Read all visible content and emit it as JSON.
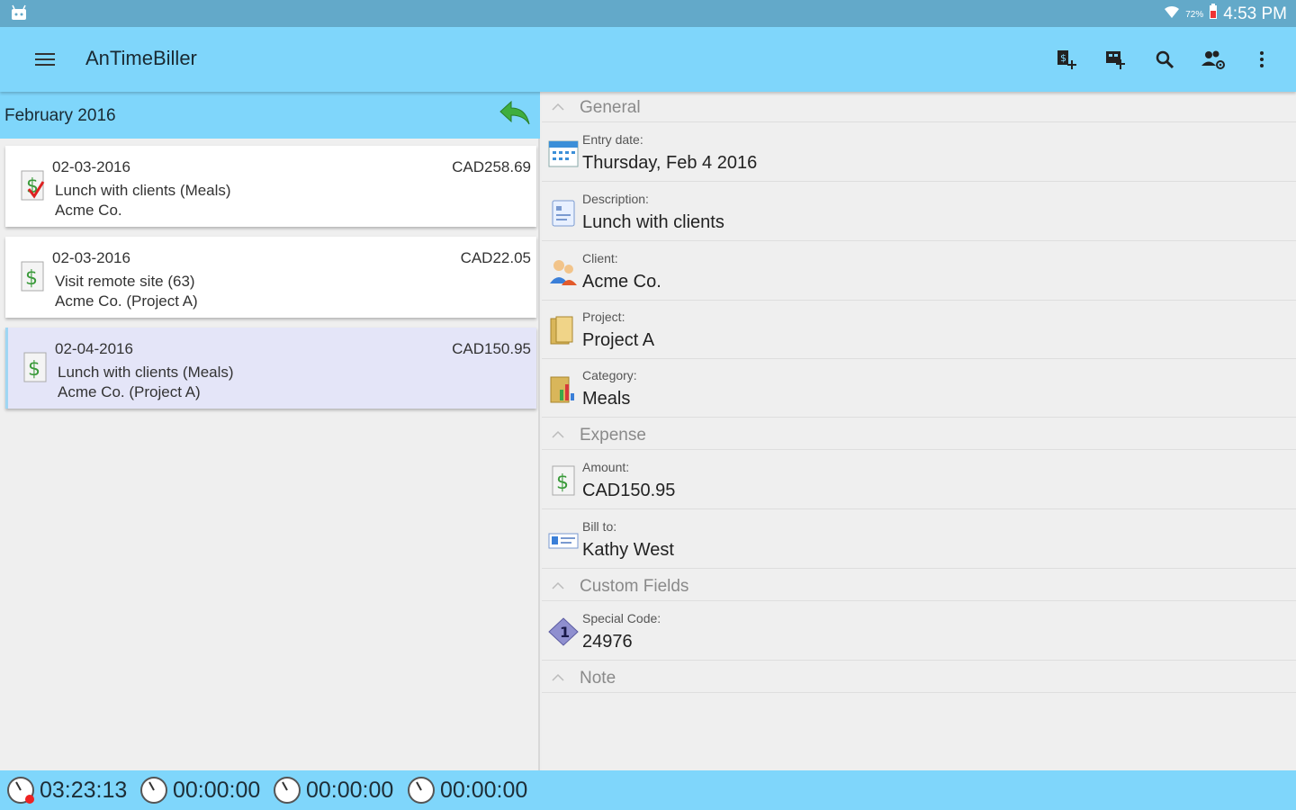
{
  "status_bar": {
    "battery_percent": "72%",
    "time": "4:53 PM",
    "icons": [
      "android-notification-icon",
      "wifi-icon",
      "battery-icon"
    ]
  },
  "app_bar": {
    "title": "AnTimeBiller",
    "actions": [
      "add-expense-icon",
      "add-time-entry-icon",
      "search-icon",
      "manage-clients-icon",
      "more-vert-icon"
    ]
  },
  "left_pane": {
    "month": "February 2016",
    "entries": [
      {
        "date": "02-03-2016",
        "amount": "CAD258.69",
        "description": "Lunch with clients (Meals)",
        "client": "Acme Co.",
        "icon": "dollar-check-icon",
        "selected": false
      },
      {
        "date": "02-03-2016",
        "amount": "CAD22.05",
        "description": "Visit remote site (63)",
        "client": "Acme Co. (Project A)",
        "icon": "dollar-doc-icon",
        "selected": false
      },
      {
        "date": "02-04-2016",
        "amount": "CAD150.95",
        "description": "Lunch with clients (Meals)",
        "client": "Acme Co. (Project A)",
        "icon": "dollar-doc-icon",
        "selected": true
      }
    ]
  },
  "detail": {
    "sections": {
      "general": "General",
      "expense": "Expense",
      "custom_fields": "Custom Fields",
      "note": "Note"
    },
    "fields": {
      "entry_date": {
        "label": "Entry date:",
        "value": "Thursday, Feb 4 2016"
      },
      "description": {
        "label": "Description:",
        "value": "Lunch with clients"
      },
      "client": {
        "label": "Client:",
        "value": "Acme Co."
      },
      "project": {
        "label": "Project:",
        "value": "Project A"
      },
      "category": {
        "label": "Category:",
        "value": "Meals"
      },
      "amount": {
        "label": "Amount:",
        "value": "CAD150.95"
      },
      "bill_to": {
        "label": "Bill to:",
        "value": "Kathy West"
      },
      "special_code": {
        "label": "Special Code:",
        "value": "24976"
      }
    }
  },
  "timers": [
    "03:23:13",
    "00:00:00",
    "00:00:00",
    "00:00:00"
  ],
  "colors": {
    "status_bar": "#63a9c9",
    "app_bar": "#7fd6fb",
    "selected_entry": "#e4e5f8",
    "dollar_green": "#3a9a3a",
    "back_arrow_green": "#3fae3f"
  }
}
